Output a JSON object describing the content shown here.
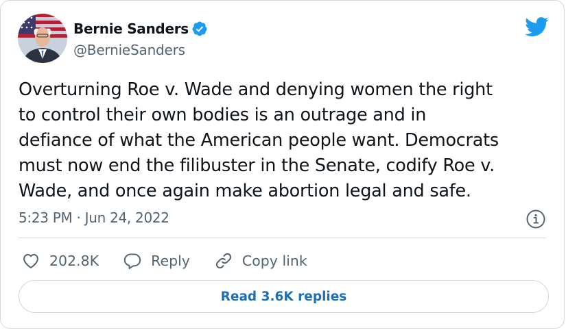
{
  "author": {
    "name": "Bernie Sanders",
    "handle": "@BernieSanders",
    "verified": true
  },
  "tweet": {
    "text": "Overturning Roe v. Wade and denying women the right\nto control their own bodies is an outrage and in\ndefiance of what the American people want. Democrats\nmust now end the filibuster in the Senate, codify Roe v.\nWade, and once again make abortion legal and safe.",
    "timestamp": "5:23 PM · Jun 24, 2022"
  },
  "actions": {
    "like_count": "202.8K",
    "reply_label": "Reply",
    "copy_link_label": "Copy link"
  },
  "read_replies_label": "Read 3.6K replies",
  "icons": {
    "brand": "twitter-bird-icon",
    "verified": "verified-badge-icon",
    "info": "info-icon",
    "like": "heart-icon",
    "reply": "reply-icon",
    "copy_link": "link-icon"
  },
  "colors": {
    "brand_blue": "#1d9bf0",
    "text": "#0f1419",
    "secondary": "#536471",
    "border": "#cfd9de",
    "link": "#1d6fb8"
  }
}
